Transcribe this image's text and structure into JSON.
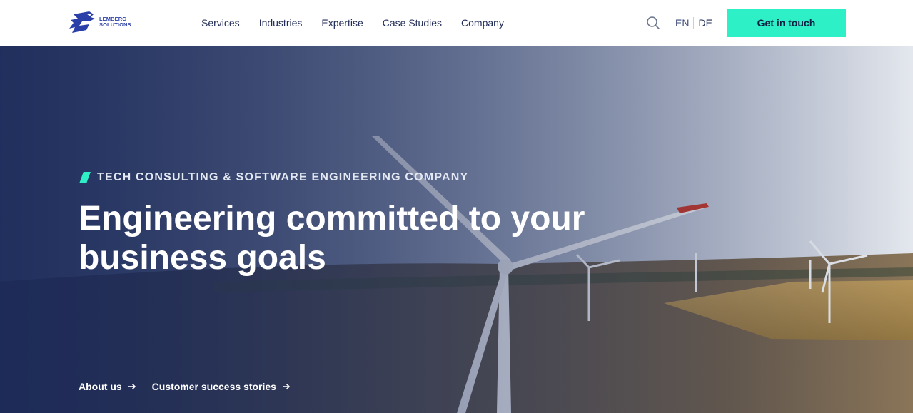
{
  "header": {
    "logo_text_line1": "LEMBERG",
    "logo_text_line2": "SOLUTIONS",
    "nav": [
      {
        "label": "Services"
      },
      {
        "label": "Industries"
      },
      {
        "label": "Expertise"
      },
      {
        "label": "Case Studies"
      },
      {
        "label": "Company"
      }
    ],
    "search_icon": "search-icon",
    "lang_en": "EN",
    "lang_de": "DE",
    "cta_label": "Get in touch"
  },
  "hero": {
    "eyebrow": "TECH CONSULTING & SOFTWARE ENGINEERING COMPANY",
    "headline_line1": "Engineering committed to your",
    "headline_line2": "business goals",
    "links": [
      {
        "label": "About us",
        "icon": "arrow-right-icon"
      },
      {
        "label": "Customer success stories",
        "icon": "arrow-right-icon"
      }
    ]
  },
  "colors": {
    "accent": "#2ef0c6",
    "brand_blue": "#2a3fa8",
    "nav_text": "#1f2a55",
    "hero_overlay": "#1c2a5a"
  }
}
